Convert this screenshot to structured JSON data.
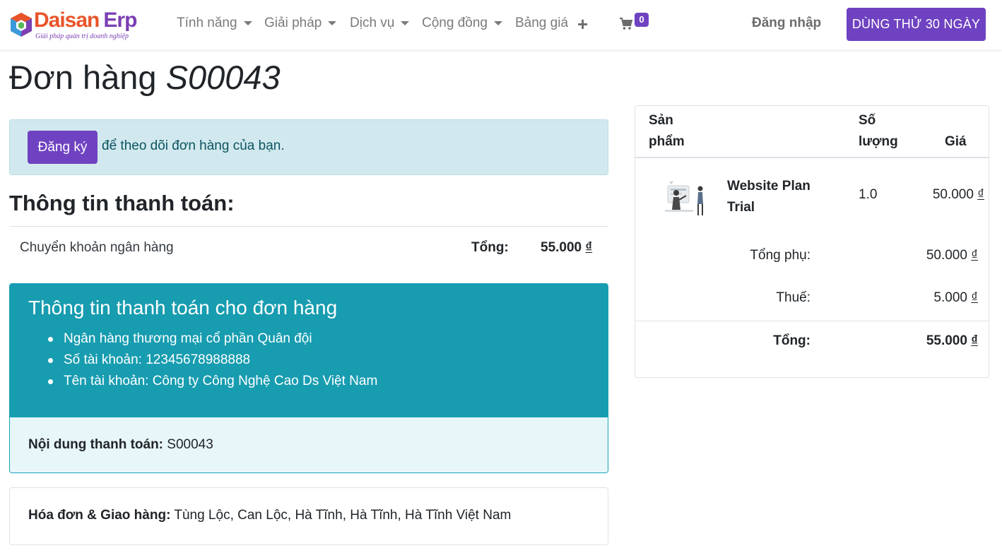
{
  "brand": {
    "name_part1": "Daisan",
    "name_part2": "Erp",
    "tagline": "Giải pháp quản trị doanh nghiệp"
  },
  "nav": {
    "items": [
      {
        "label": "Tính năng"
      },
      {
        "label": "Giải pháp"
      },
      {
        "label": "Dịch vụ"
      },
      {
        "label": "Cộng đồng"
      },
      {
        "label": "Bảng giá"
      }
    ],
    "cart_count": "0",
    "login_label": "Đăng nhập",
    "trial_label": "DÙNG THỬ 30 NGÀY",
    "accent_color": "#6f42c1"
  },
  "page": {
    "title_prefix": "Đơn hàng",
    "order_number": "S00043"
  },
  "alert": {
    "register_label": "Đăng ký",
    "text": "để theo dõi đơn hàng của bạn."
  },
  "payment": {
    "heading": "Thông tin thanh toán:",
    "method": "Chuyển khoản ngân hàng",
    "total_label": "Tổng:",
    "total_value": "55.000",
    "currency": "₫"
  },
  "bank": {
    "title": "Thông tin thanh toán cho đơn hàng",
    "lines": [
      "Ngân hàng thương mại cổ phần Quân đội",
      "Số tài khoản: 12345678988888",
      "Tên tài khoản: Công ty Công Nghệ Cao Ds Việt Nam"
    ],
    "content_label": "Nội dung thanh toán:",
    "content_value": "S00043",
    "color": "#179cb0"
  },
  "address": {
    "label": "Hóa đơn & Giao hàng:",
    "value": "Tùng Lộc, Can Lộc, Hà Tĩnh, Hà Tĩnh, Hà Tĩnh Việt Nam"
  },
  "order": {
    "headers": {
      "product_1": "Sản",
      "product_2": "phẩm",
      "qty_1": "Số",
      "qty_2": "lượng",
      "price": "Giá"
    },
    "lines": [
      {
        "name_1": "Website Plan",
        "name_2": "Trial",
        "qty": "1.0",
        "price": "50.000"
      }
    ],
    "subtotal_label": "Tổng phụ:",
    "subtotal_value": "50.000",
    "tax_label": "Thuế:",
    "tax_value": "5.000",
    "total_label": "Tổng:",
    "total_value": "55.000",
    "currency": "₫"
  }
}
